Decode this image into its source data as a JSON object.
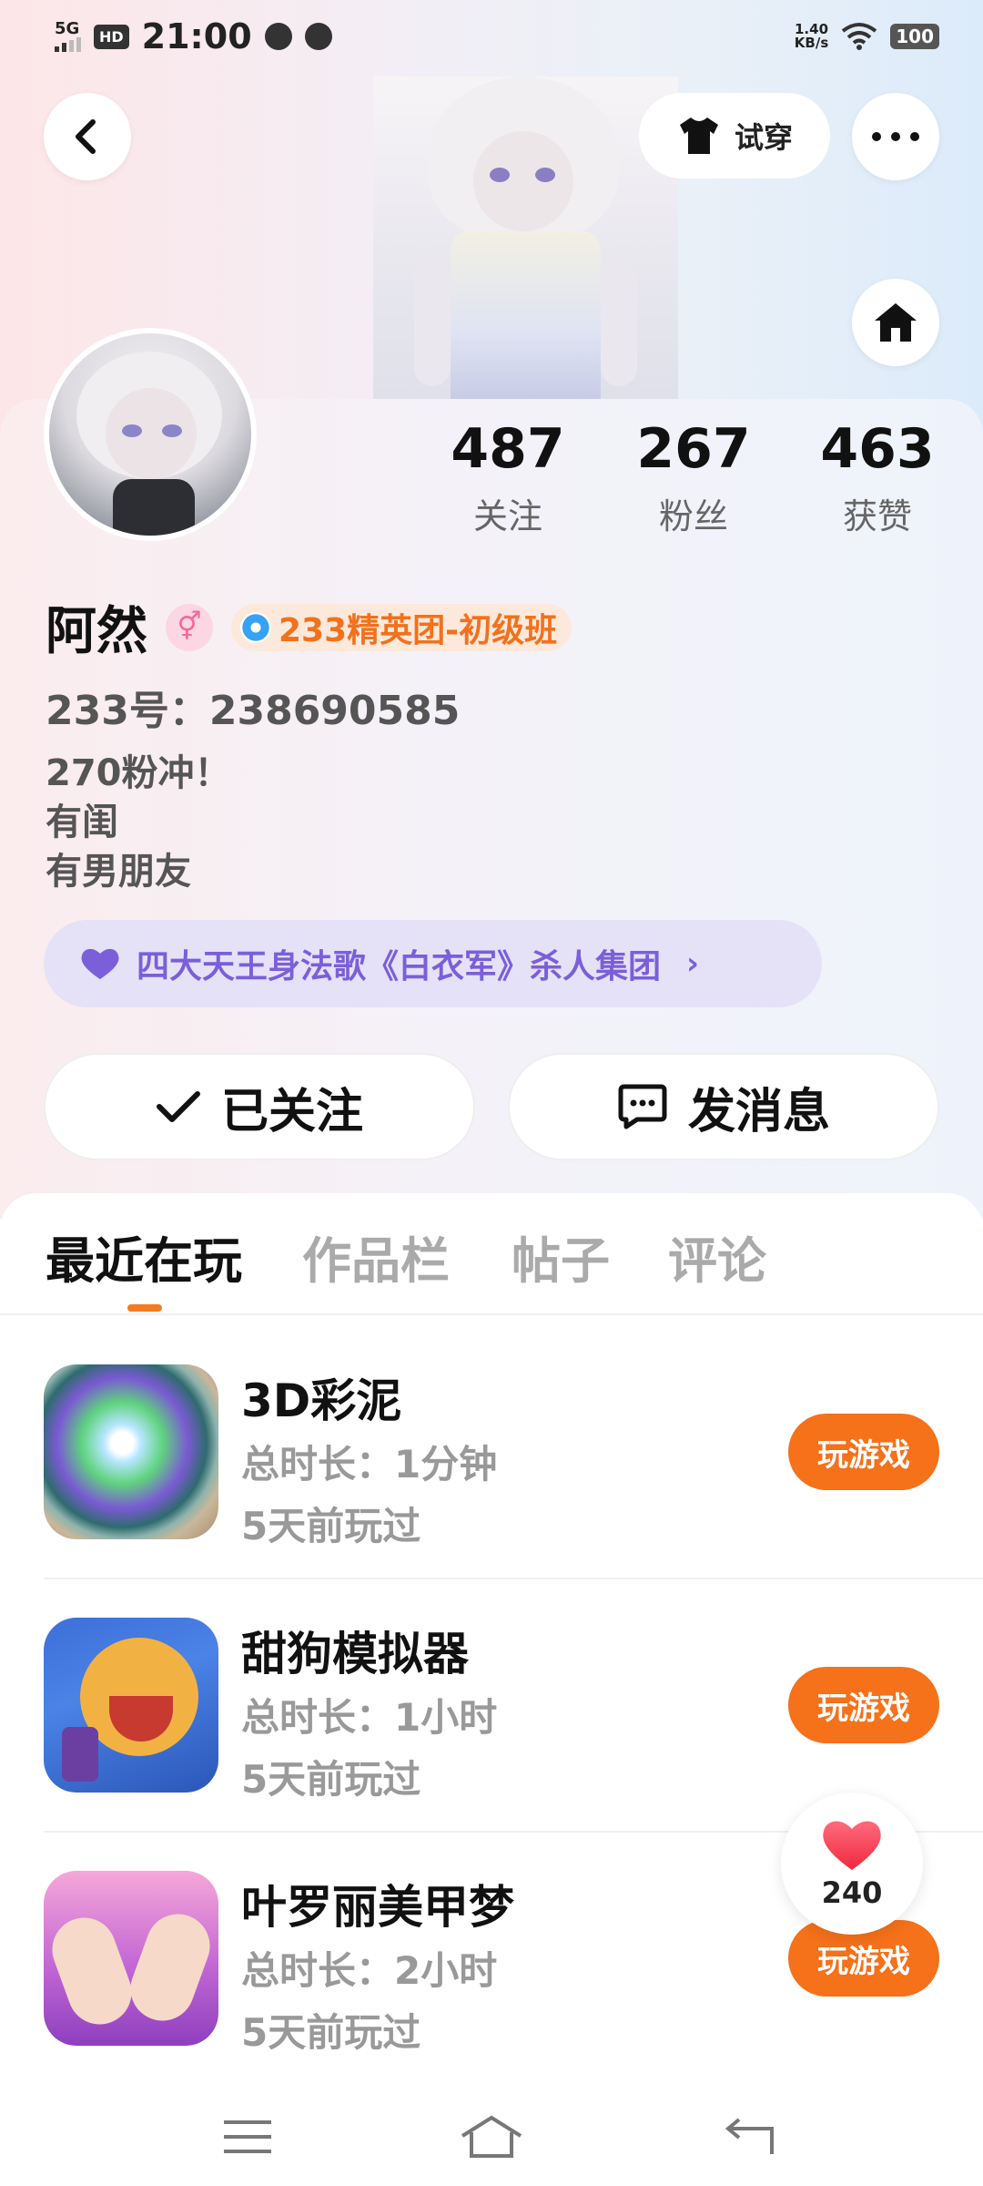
{
  "status_bar": {
    "network": "5G",
    "hd": "HD",
    "time": "21:00",
    "speed_value": "1.40",
    "speed_unit": "KB/s",
    "battery": "100"
  },
  "header": {
    "tryon_label": "试穿"
  },
  "profile": {
    "name": "阿然",
    "gender_symbol": "⚥",
    "rank_label": "233精英团-初级班",
    "uid_text": "233号：238690585",
    "bio_lines": [
      "270粉冲！",
      "有闺",
      "有男朋友"
    ],
    "group_label": "四大天王身法歌《白衣军》杀人集团"
  },
  "stats": [
    {
      "value": "487",
      "label": "关注"
    },
    {
      "value": "267",
      "label": "粉丝"
    },
    {
      "value": "463",
      "label": "获赞"
    }
  ],
  "actions": {
    "follow_label": "已关注",
    "message_label": "发消息"
  },
  "tabs": [
    "最近在玩",
    "作品栏",
    "帖子",
    "评论"
  ],
  "games": [
    {
      "title": "3D彩泥",
      "duration": "总时长：1分钟",
      "last_played": "5天前玩过",
      "button": "玩游戏"
    },
    {
      "title": "甜狗模拟器",
      "duration": "总时长：1小时",
      "last_played": "5天前玩过",
      "button": "玩游戏"
    },
    {
      "title": "叶罗丽美甲梦",
      "duration": "总时长：2小时",
      "last_played": "5天前玩过",
      "button": "玩游戏"
    }
  ],
  "like_fab": {
    "count": "240"
  },
  "colors": {
    "accent": "#f5711a",
    "group_text": "#7a5fd9",
    "rank_text": "#f2711c"
  },
  "icons": {
    "back": "back-arrow-icon",
    "shirt": "shirt-icon",
    "more": "more-dots-icon",
    "home": "home-icon",
    "heart": "heart-icon",
    "check": "check-icon",
    "chat": "chat-bubble-icon"
  }
}
